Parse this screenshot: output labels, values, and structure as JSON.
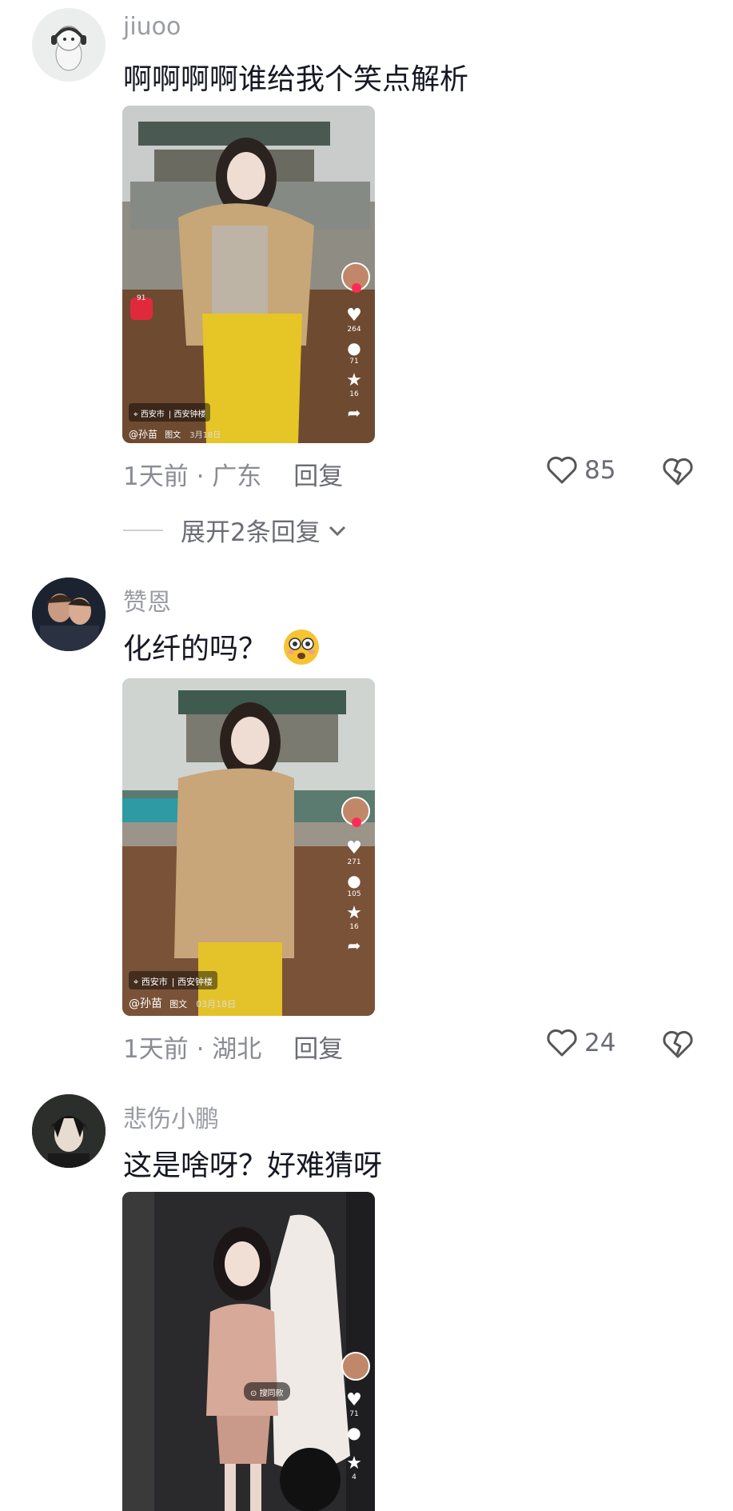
{
  "comments": [
    {
      "username": "jiuoo",
      "text": "啊啊啊啊谁给我个笑点解析",
      "time": "1天前",
      "location": "广东",
      "reply_label": "回复",
      "likes": "85",
      "expand_label": "展开2条回复",
      "thumb": {
        "location": "西安市",
        "place": "西安钟楼",
        "author": "@孙苗",
        "type_label": "图文",
        "date": "3月18日",
        "stats": [
          "264",
          "71",
          "16"
        ],
        "badge": "91"
      }
    },
    {
      "username": "赞恩",
      "text": "化纤的吗？",
      "time": "1天前",
      "location": "湖北",
      "reply_label": "回复",
      "likes": "24",
      "thumb": {
        "location": "西安市",
        "place": "西安钟楼",
        "author": "@孙苗",
        "type_label": "图文",
        "date": "03月18日",
        "stats": [
          "271",
          "105",
          "16"
        ]
      }
    },
    {
      "username": "悲伤小鹏",
      "text": "这是啥呀？好难猜呀",
      "thumb": {
        "search_label": "搜同款",
        "stats": [
          "71",
          "4"
        ]
      }
    }
  ],
  "colors": {
    "username": "#9a9ca3",
    "text": "#161823",
    "meta": "#8a8c93",
    "accent_red": "#fe2c55"
  }
}
